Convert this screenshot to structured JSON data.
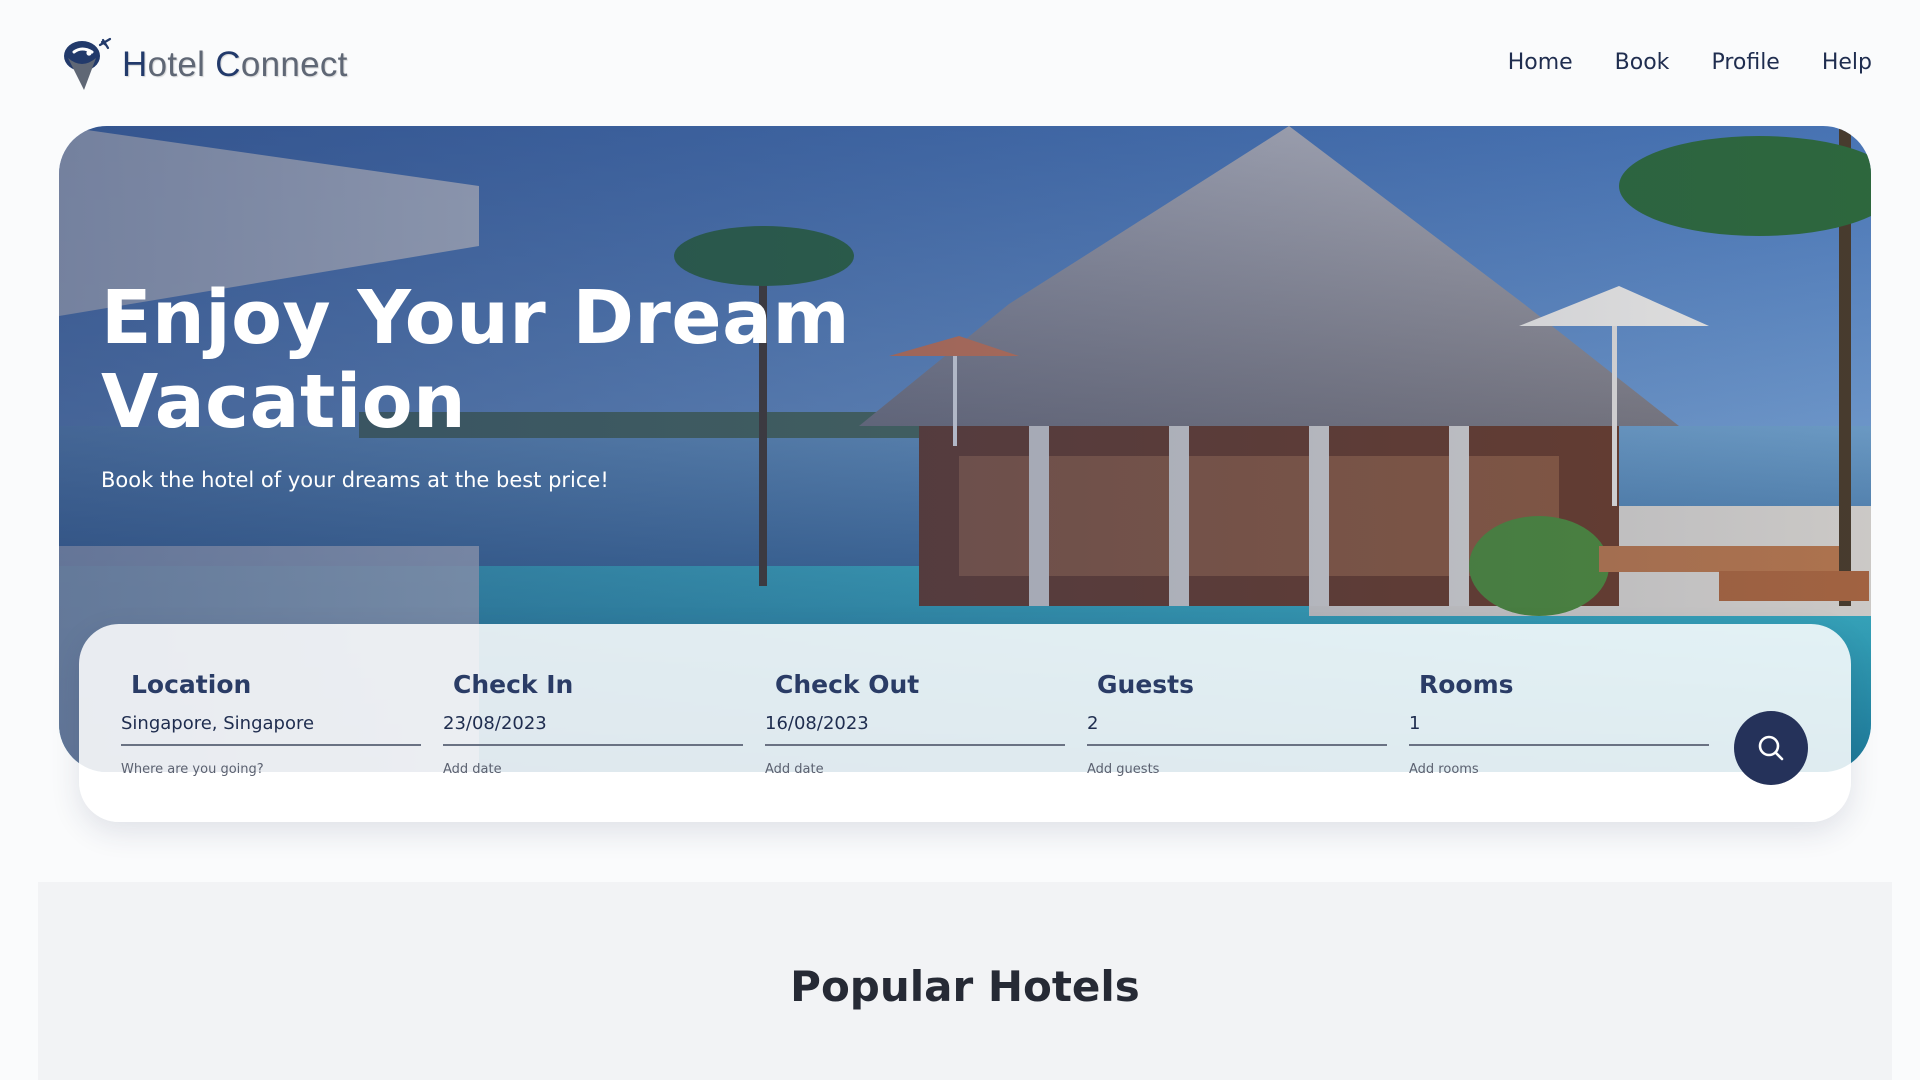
{
  "brand": {
    "name_first_cap": "H",
    "name_first_rest": "otel ",
    "name_second_cap": "C",
    "name_second_rest": "onnect",
    "logo_icon": "plane-pin-logo"
  },
  "nav": {
    "items": [
      {
        "label": "Home"
      },
      {
        "label": "Book"
      },
      {
        "label": "Profile"
      },
      {
        "label": "Help"
      }
    ]
  },
  "hero": {
    "title": "Enjoy Your Dream Vacation",
    "subtitle": "Book the hotel of your dreams at the best price!"
  },
  "search": {
    "fields": [
      {
        "label": "Location",
        "value": "Singapore, Singapore",
        "hint": "Where are you going?"
      },
      {
        "label": "Check In",
        "value": "23/08/2023",
        "hint": "Add date"
      },
      {
        "label": "Check Out",
        "value": "16/08/2023",
        "hint": "Add date"
      },
      {
        "label": "Guests",
        "value": "2",
        "hint": "Add guests"
      },
      {
        "label": "Rooms",
        "value": "1",
        "hint": "Add rooms"
      }
    ],
    "button_icon": "search-icon"
  },
  "popular": {
    "title": "Popular Hotels"
  },
  "colors": {
    "primary": "#25325a",
    "brand_navy": "#223a6b",
    "brand_gray": "#5f6775",
    "section_bg": "#f2f3f5"
  }
}
